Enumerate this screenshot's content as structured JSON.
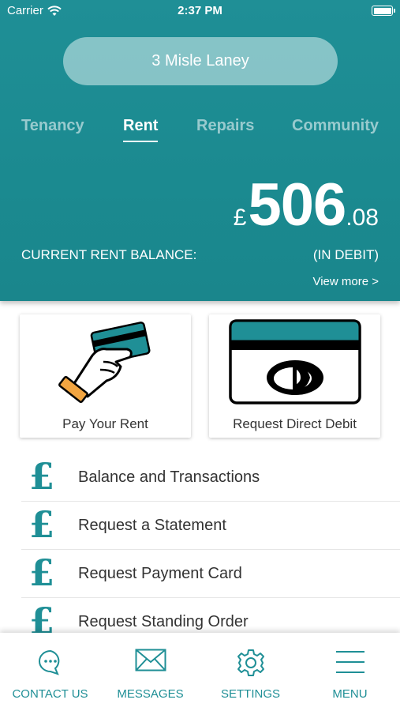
{
  "status_bar": {
    "carrier": "Carrier",
    "time": "2:37 PM"
  },
  "property": {
    "address": "3 Misle Laney"
  },
  "tabs": [
    {
      "label": "Tenancy"
    },
    {
      "label": "Rent",
      "active": true
    },
    {
      "label": "Repairs"
    },
    {
      "label": "Community"
    }
  ],
  "balance": {
    "currency": "£",
    "whole": "506",
    "decimal": ".08",
    "label": "CURRENT RENT BALANCE:",
    "status": "(IN DEBIT)",
    "view_more": "View more >"
  },
  "cards": {
    "pay_rent": "Pay Your Rent",
    "direct_debit": "Request Direct Debit"
  },
  "list_items": [
    {
      "label": "Balance and Transactions"
    },
    {
      "label": "Request a Statement"
    },
    {
      "label": "Request Payment Card"
    },
    {
      "label": "Request Standing Order"
    }
  ],
  "list_icon_glyph": "£",
  "bottom_nav": [
    {
      "label": "CONTACT US",
      "icon": "chat-bubble-icon"
    },
    {
      "label": "MESSAGES",
      "icon": "envelope-icon"
    },
    {
      "label": "SETTINGS",
      "icon": "gear-icon"
    },
    {
      "label": "MENU",
      "icon": "hamburger-menu-icon"
    }
  ],
  "colors": {
    "brand": "#1f8f96"
  }
}
